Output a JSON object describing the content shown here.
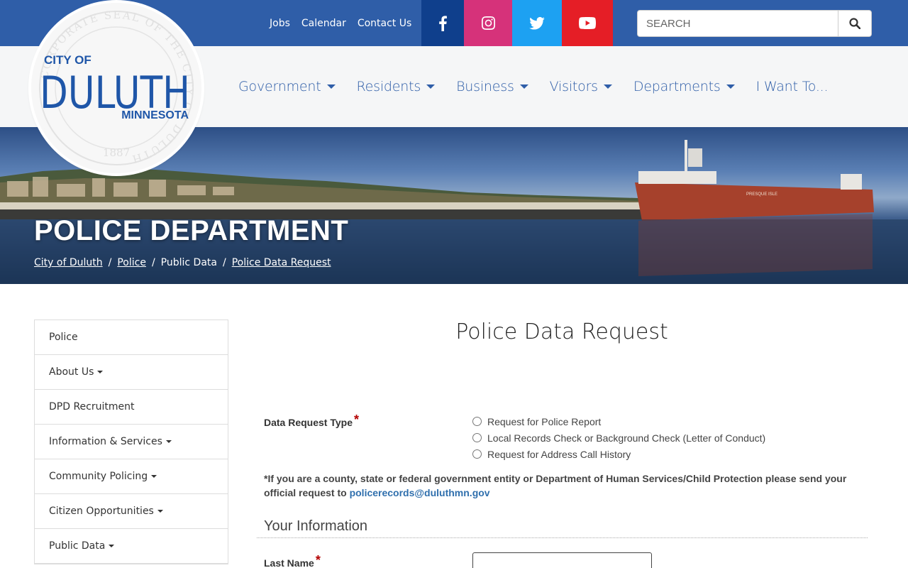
{
  "topbar": {
    "links": [
      "Jobs",
      "Calendar",
      "Contact Us"
    ],
    "social": [
      {
        "name": "facebook",
        "icon": "facebook-icon",
        "color": "#0f3f8c"
      },
      {
        "name": "instagram",
        "icon": "instagram-icon",
        "color": "#d6327a"
      },
      {
        "name": "twitter",
        "icon": "twitter-icon",
        "color": "#1da1f2"
      },
      {
        "name": "youtube",
        "icon": "youtube-icon",
        "color": "#e51e26"
      }
    ],
    "search_placeholder": "SEARCH",
    "color": "#2f5ea8"
  },
  "logo": {
    "city_of": "CITY OF",
    "name": "DULUTH",
    "state": "MINNESOTA",
    "seal_text": "CORPORATE SEAL OF THE CITY OF DULUTH",
    "year": "1887"
  },
  "nav": {
    "items": [
      {
        "label": "Government",
        "dropdown": true
      },
      {
        "label": "Residents",
        "dropdown": true
      },
      {
        "label": "Business",
        "dropdown": true
      },
      {
        "label": "Visitors",
        "dropdown": true
      },
      {
        "label": "Departments",
        "dropdown": true
      },
      {
        "label": "I Want To...",
        "dropdown": false
      }
    ]
  },
  "hero": {
    "title": "POLICE DEPARTMENT",
    "breadcrumbs": [
      "City of Duluth",
      "Police",
      "Public Data",
      "Police Data Request"
    ],
    "ship_name": "PRESQUE ISLE"
  },
  "sidebar": {
    "items": [
      {
        "label": "Police",
        "dropdown": false
      },
      {
        "label": "About Us",
        "dropdown": true
      },
      {
        "label": "DPD Recruitment",
        "dropdown": false
      },
      {
        "label": "Information & Services",
        "dropdown": true
      },
      {
        "label": "Community Policing",
        "dropdown": true
      },
      {
        "label": "Citizen Opportunities",
        "dropdown": true
      },
      {
        "label": "Public Data",
        "dropdown": true
      }
    ]
  },
  "main": {
    "title": "Police Data Request",
    "request_type_label": "Data Request Type",
    "required_mark": "*",
    "options": [
      "Request for Police Report",
      "Local Records Check or Background Check (Letter of Conduct)",
      "Request for Address Call History"
    ],
    "note_text": "*If you are a county, state or federal government entity or Department of Human Services/Child Protection please send your official request to",
    "note_email": "policerecords@duluthmn.gov",
    "section_title": "Your Information",
    "last_name_label": "Last Name"
  }
}
